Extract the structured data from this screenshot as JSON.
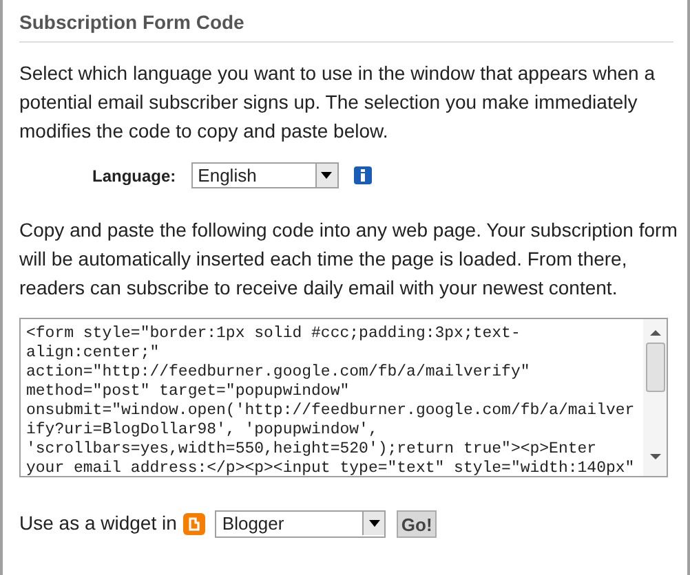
{
  "section_title": "Subscription Form Code",
  "intro": "Select which language you want to use in the window that appears when a potential email subscriber signs up. The selection you make immediately modifies the code to copy and paste below.",
  "language": {
    "label": "Language:",
    "value": "English"
  },
  "instructions": "Copy and paste the following code into any web page. Your subscription form will be automatically inserted each time the page is loaded. From there, readers can subscribe to receive daily email with your newest content.",
  "code_lines": [
    "<form style=\"border:1px solid #ccc;padding:3px;text-",
    "align:center;\"",
    "action=\"http://feedburner.google.com/fb/a/mailverify\"",
    "method=\"post\" target=\"popupwindow\"",
    "onsubmit=\"window.open('http://feedburner.google.com/fb/a/mailver",
    "ify?uri=BlogDollar98', 'popupwindow',",
    "'scrollbars=yes,width=550,height=520');return true\"><p>Enter",
    "your email address:</p><p><input type=\"text\" style=\"width:140px\""
  ],
  "widget": {
    "label": "Use as a widget in",
    "value": "Blogger",
    "button": "Go!"
  }
}
